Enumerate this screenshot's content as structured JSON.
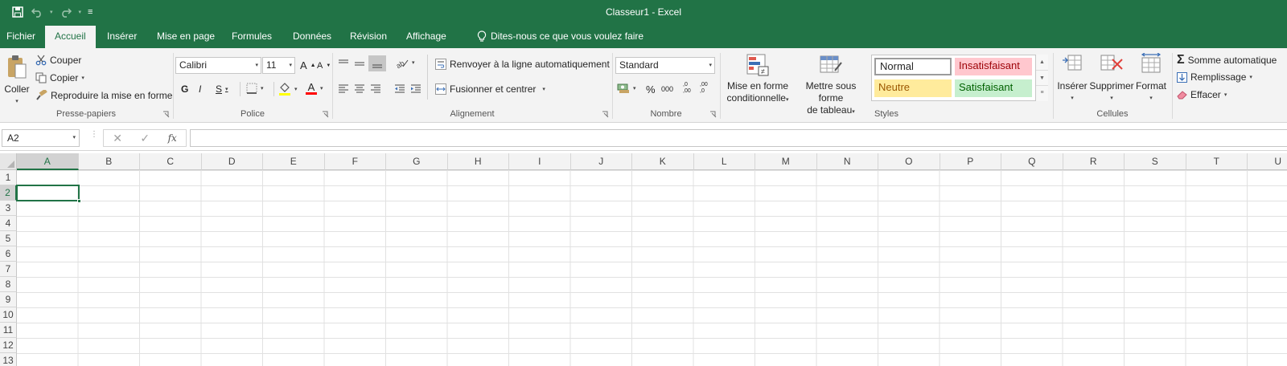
{
  "window": {
    "title": "Classeur1  -  Excel"
  },
  "colors": {
    "accent": "#217346",
    "ribbon_bg": "#f3f3f3"
  },
  "quick_access": {
    "icons": [
      "save-icon",
      "undo-icon",
      "redo-icon",
      "customize-qat-icon"
    ],
    "customize_glyph": "≡"
  },
  "tabs": [
    {
      "label": "Fichier"
    },
    {
      "label": "Accueil",
      "active": true
    },
    {
      "label": "Insérer"
    },
    {
      "label": "Mise en page"
    },
    {
      "label": "Formules"
    },
    {
      "label": "Données"
    },
    {
      "label": "Révision"
    },
    {
      "label": "Affichage"
    }
  ],
  "tell_me": "Dites-nous ce que vous voulez faire",
  "ribbon": {
    "clipboard": {
      "label": "Presse-papiers",
      "paste": "Coller",
      "cut": "Couper",
      "copy": "Copier",
      "format_painter": "Reproduire la mise en forme"
    },
    "font": {
      "label": "Police",
      "font_name": "Calibri",
      "font_size": "11",
      "grow": "A",
      "shrink": "A",
      "bold": "G",
      "italic": "I",
      "underline": "S",
      "font_color_letter": "A",
      "highlight_color": "#ffff00",
      "font_color": "#ff0000"
    },
    "alignment": {
      "label": "Alignement",
      "wrap_text": "Renvoyer à la ligne automatiquement",
      "merge_center": "Fusionner et centrer"
    },
    "number": {
      "label": "Nombre",
      "format": "Standard",
      "percent": "%",
      "thousands": "000",
      "inc_decimal": ",0\n,00",
      "dec_decimal": ",00\n,0"
    },
    "styles": {
      "label": "Styles",
      "conditional_formatting": [
        "Mise en forme",
        "conditionnelle"
      ],
      "format_as_table": [
        "Mettre sous forme",
        "de tableau"
      ],
      "gallery": [
        {
          "name": "Normal",
          "bg": "#ffffff",
          "color": "#000000"
        },
        {
          "name": "Insatisfaisant",
          "bg": "#ffc7ce",
          "color": "#9c0006"
        },
        {
          "name": "Neutre",
          "bg": "#ffeb9c",
          "color": "#9c5700"
        },
        {
          "name": "Satisfaisant",
          "bg": "#c6efce",
          "color": "#006100"
        }
      ]
    },
    "cells": {
      "label": "Cellules",
      "insert": "Insérer",
      "delete": "Supprimer",
      "format": "Format"
    },
    "editing": {
      "autosum": "Somme automatique",
      "fill": "Remplissage",
      "clear": "Effacer"
    }
  },
  "formula_bar": {
    "name_box": "A2",
    "cancel": "✕",
    "enter": "✓",
    "fx": "fx",
    "value": ""
  },
  "sheet": {
    "columns": [
      "A",
      "B",
      "C",
      "D",
      "E",
      "F",
      "G",
      "H",
      "I",
      "J",
      "K",
      "L",
      "M",
      "N",
      "O",
      "P",
      "Q",
      "R",
      "S",
      "T",
      "U"
    ],
    "rows": [
      "1",
      "2",
      "3",
      "4",
      "5",
      "6",
      "7",
      "8",
      "9",
      "10",
      "11",
      "12",
      "13"
    ],
    "selected_column": "A",
    "selected_row": "2"
  }
}
